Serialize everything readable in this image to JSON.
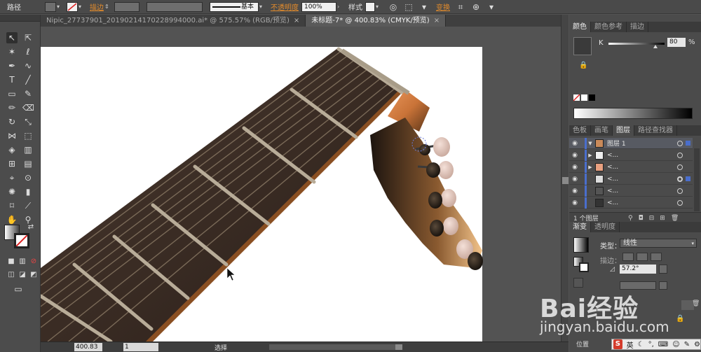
{
  "control_bar": {
    "selection_label": "路径",
    "stroke_label": "描边",
    "stroke_style": "基本",
    "opacity_label": "不透明度",
    "opacity_value": "100%",
    "style_label": "样式",
    "transform_label": "变换"
  },
  "tabs": [
    {
      "label": "Nipic_27737901_20190214170228994000.ai* @ 575.57% (RGB/预览)",
      "active": false
    },
    {
      "label": "未标题-7* @ 400.83% (CMYK/预览)",
      "active": true
    }
  ],
  "status": {
    "zoom": "400.83",
    "page": "1",
    "mode": "选择"
  },
  "color_panel": {
    "tabs": [
      "颜色",
      "颜色参考",
      "描边"
    ],
    "channel": "K",
    "value": "80",
    "unit": "%"
  },
  "layers_panel": {
    "tabs": [
      "色板",
      "画笔",
      "图层",
      "路径查找器"
    ],
    "top_layer": "图层 1",
    "sublayer_names": [
      "<...",
      "<...",
      "<...",
      "<...",
      "<..."
    ],
    "count": "1 个图层"
  },
  "gradient_panel": {
    "tabs": [
      "渐变",
      "透明度"
    ],
    "type_label": "类型",
    "type_value": "线性",
    "stroke_label": "描边",
    "angle": "57.2°",
    "location_label": "位置"
  },
  "watermark": {
    "logo": "Bai经验",
    "url": "jingyan.baidu.com"
  },
  "ime": {
    "lang": "英"
  },
  "colors": {
    "panel_bg": "#4b4b4b",
    "accent_orange": "#e08a2c",
    "layer_blue": "#4a6ecc",
    "fretboard": "#3a2a22",
    "headstock_warm": "#c9742e"
  }
}
